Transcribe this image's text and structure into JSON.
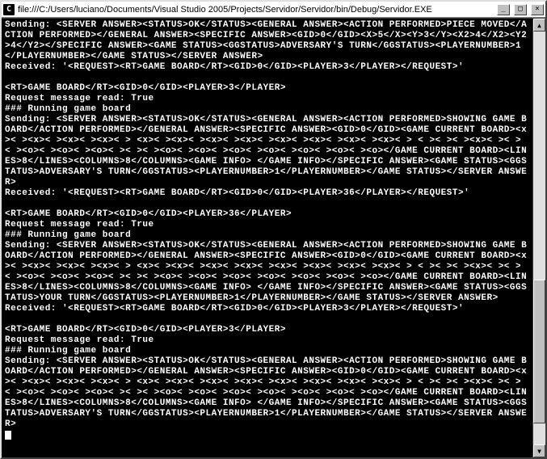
{
  "app": {
    "icon_letter": "C",
    "title_path": "file:///C:/Users/luciano/Documents/Visual Studio 2005/Projects/Servidor/Servidor/bin/Debug/Servidor.EXE",
    "minimize_glyph": "_",
    "maximize_glyph": "□",
    "close_glyph": "×"
  },
  "scrollbar": {
    "up_glyph": "▲",
    "down_glyph": "▼"
  },
  "console": {
    "lines": [
      "Sending: <SERVER ANSWER><STATUS>OK</STATUS><GENERAL ANSWER><ACTION PERFORMED>PIECE MOVED</ACTION PERFORMED></GENERAL ANSWER><SPECIFIC ANSWER><GID>0</GID><X>5</X><Y>3</Y><X2>4</X2><Y2>4</Y2></SPECIFIC ANSWER><GAME STATUS><GGSTATUS>ADVERSARY'S TURN</GGSTATUS><PLAYERNUMBER>1</PLAYERNUMBER></GAME STATUS></SERVER ANSWER>",
      "Received: '<REQUEST><RT>GAME BOARD</RT><GID>0</GID><PLAYER>3</PLAYER></REQUEST>'",
      "",
      "<RT>GAME BOARD</RT><GID>0</GID><PLAYER>3</PLAYER>",
      "Request message read: True",
      "### Running game board",
      "Sending: <SERVER ANSWER><STATUS>OK</STATUS><GENERAL ANSWER><ACTION PERFORMED>SHOWING GAME BOARD</ACTION PERFORMED></GENERAL ANSWER><SPECIFIC ANSWER><GID>0</GID><GAME CURRENT BOARD><x>< ><x>< ><x>< ><x>< > <x>< ><x>< ><x>< ><x>< ><x>< ><x>< ><x>< ><x>< > < >< >< ><x>< >< > < ><o>< ><o>< ><o>< >< >< ><o>< ><o>< ><o>< ><o>< ><o>< ><o>< ><o></GAME CURRENT BOARD><LINES>8</LINES><COLUMNS>8</COLUMNS><GAME INFO> </GAME INFO></SPECIFIC ANSWER><GAME STATUS><GGSTATUS>ADVERSARY'S TURN</GGSTATUS><PLAYERNUMBER>1</PLAYERNUMBER></GAME STATUS></SERVER ANSWER>",
      "Received: '<REQUEST><RT>GAME BOARD</RT><GID>0</GID><PLAYER>36</PLAYER></REQUEST>'",
      "",
      "<RT>GAME BOARD</RT><GID>0</GID><PLAYER>36</PLAYER>",
      "Request message read: True",
      "### Running game board",
      "Sending: <SERVER ANSWER><STATUS>OK</STATUS><GENERAL ANSWER><ACTION PERFORMED>SHOWING GAME BOARD</ACTION PERFORMED></GENERAL ANSWER><SPECIFIC ANSWER><GID>0</GID><GAME CURRENT BOARD><x>< ><x>< ><x>< ><x>< > <x>< ><x>< ><x>< ><x>< ><x>< ><x>< ><x>< ><x>< > < >< >< ><x>< >< > < ><o>< ><o>< ><o>< >< >< ><o>< ><o>< ><o>< ><o>< ><o>< ><o>< ><o></GAME CURRENT BOARD><LINES>8</LINES><COLUMNS>8</COLUMNS><GAME INFO> </GAME INFO></SPECIFIC ANSWER><GAME STATUS><GGSTATUS>YOUR TURN</GGSTATUS><PLAYERNUMBER>1</PLAYERNUMBER></GAME STATUS></SERVER ANSWER>",
      "Received: '<REQUEST><RT>GAME BOARD</RT><GID>0</GID><PLAYER>3</PLAYER></REQUEST>'",
      "",
      "<RT>GAME BOARD</RT><GID>0</GID><PLAYER>3</PLAYER>",
      "Request message read: True",
      "### Running game board",
      "Sending: <SERVER ANSWER><STATUS>OK</STATUS><GENERAL ANSWER><ACTION PERFORMED>SHOWING GAME BOARD</ACTION PERFORMED></GENERAL ANSWER><SPECIFIC ANSWER><GID>0</GID><GAME CURRENT BOARD><x>< ><x>< ><x>< ><x>< > <x>< ><x>< ><x>< ><x>< ><x>< ><x>< ><x>< ><x>< > < >< >< ><x>< >< > < ><o>< ><o>< ><o>< >< >< ><o>< ><o>< ><o>< ><o>< ><o>< ><o>< ><o></GAME CURRENT BOARD><LINES>8</LINES><COLUMNS>8</COLUMNS><GAME INFO> </GAME INFO></SPECIFIC ANSWER><GAME STATUS><GGSTATUS>ADVERSARY'S TURN</GGSTATUS><PLAYERNUMBER>1</PLAYERNUMBER></GAME STATUS></SERVER ANSWER>"
    ]
  }
}
